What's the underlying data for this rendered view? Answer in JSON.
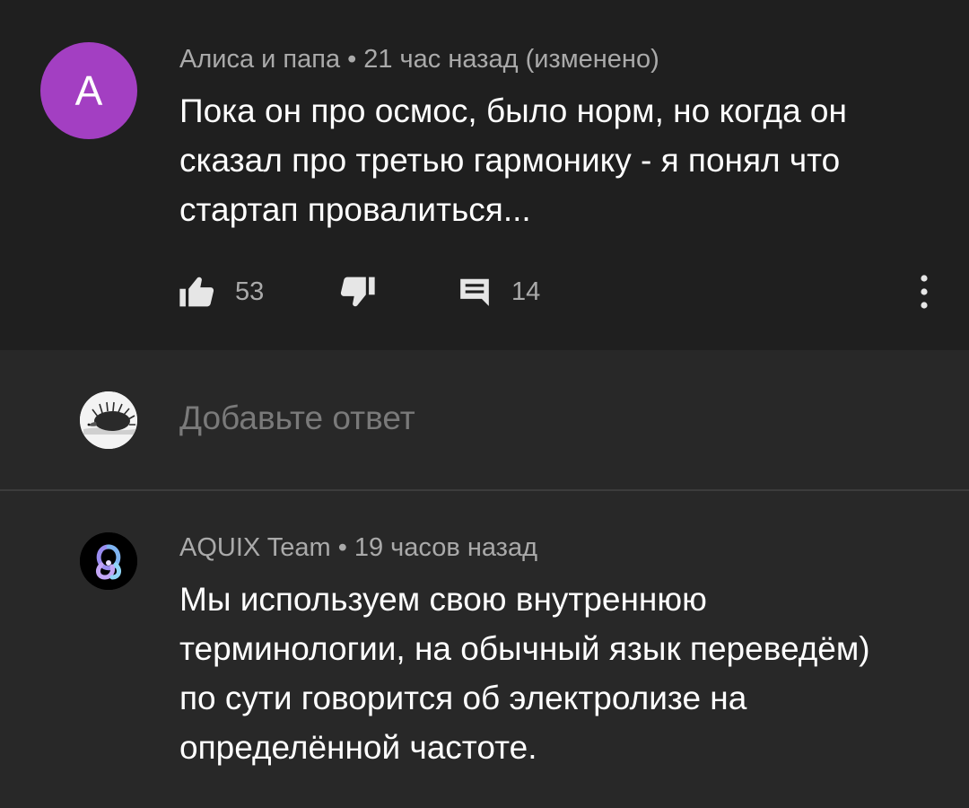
{
  "comment": {
    "avatar_letter": "A",
    "author": "Алиса и папа",
    "separator": "•",
    "time": "21 час назад (изменено)",
    "lines": [
      "Пока он про осмос, было норм, но когда он",
      "сказал про третью гармонику - я понял что",
      "стартап провалиться..."
    ],
    "likes": "53",
    "replies": "14",
    "colors": {
      "avatar_bg": "#a33fc2",
      "meta": "#aaaaaa",
      "background": "#1f1f1f"
    },
    "icons": [
      "thumbs-up-icon",
      "thumbs-down-icon",
      "reply-icon",
      "more-vert-icon"
    ]
  },
  "reply_box": {
    "placeholder": "Добавьте ответ",
    "avatar_icon": "hedgehog-avatar-icon"
  },
  "reply": {
    "author": "AQUIX Team",
    "separator": "•",
    "time": "19 часов назад",
    "lines": [
      "Мы используем свою внутреннюю",
      "терминологии, на обычный язык переведём)",
      "по сути говорится об электролизе на",
      "определённой частоте."
    ],
    "avatar_icon": "aquix-logo-icon"
  }
}
